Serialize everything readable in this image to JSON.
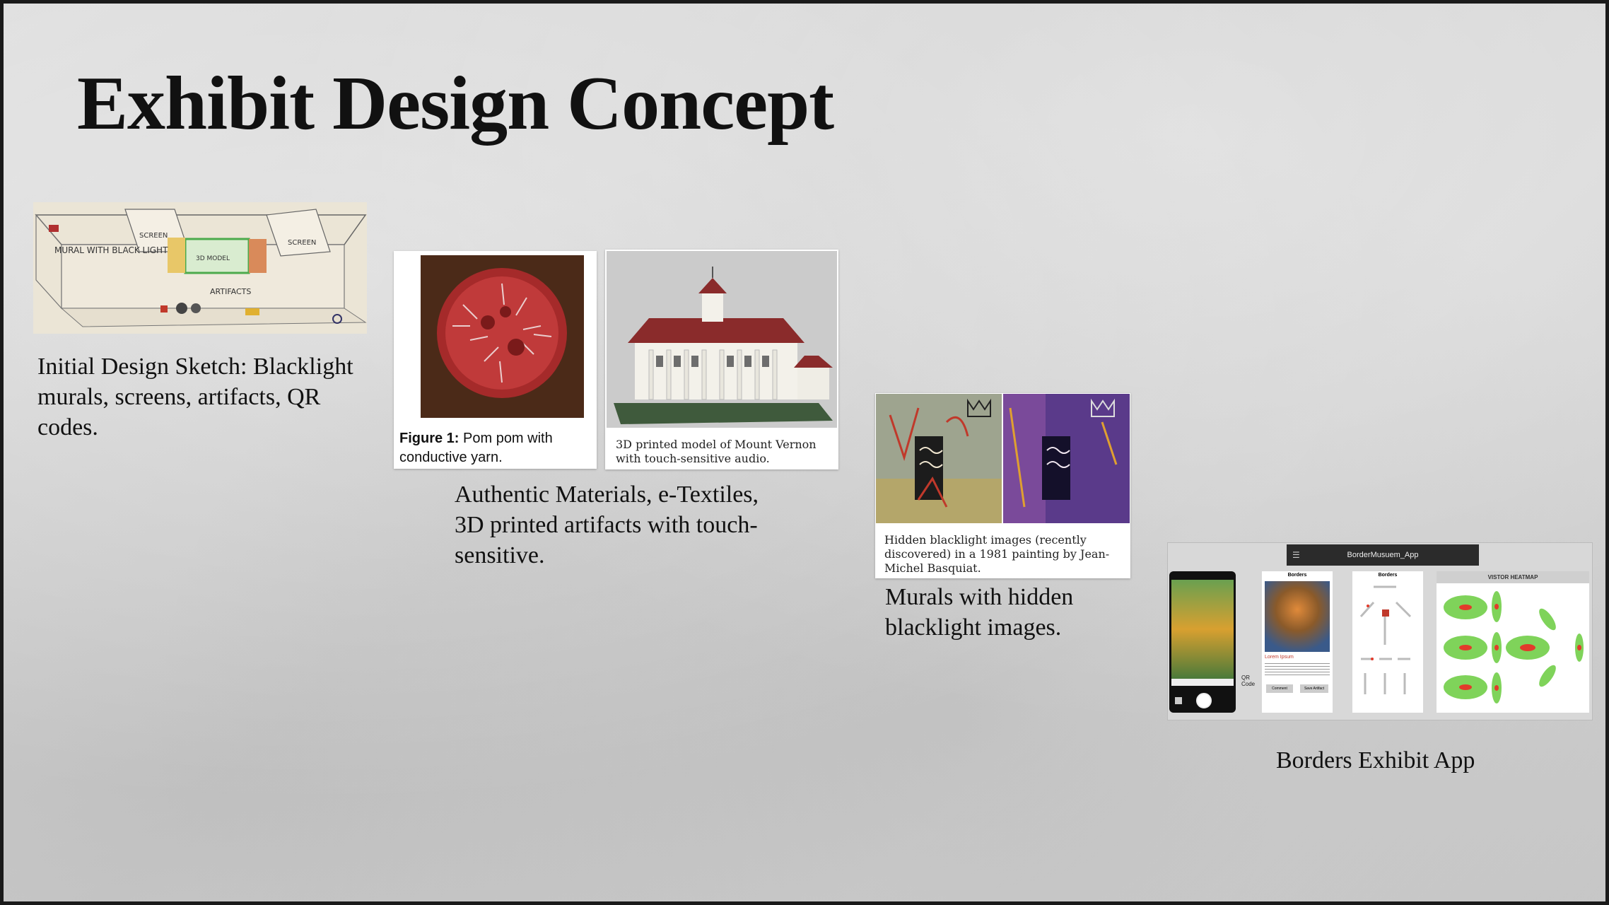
{
  "slide": {
    "title": "Exhibit Design Concept"
  },
  "sketch": {
    "caption": "Initial Design Sketch: Blacklight murals, screens, artifacts, QR codes.",
    "labels": [
      "MURAL WITH BLACK LIGHT",
      "SCREEN",
      "3D MODEL",
      "SCREEN",
      "ARTIFACTS"
    ]
  },
  "pompom": {
    "caption_bold": "Figure 1:",
    "caption_text": " Pom pom with conductive yarn."
  },
  "vernon": {
    "caption": "3D printed model of Mount Vernon with touch-sensitive audio."
  },
  "materials": {
    "caption": "Authentic Materials, e-Textiles, 3D printed artifacts with touch-sensitive."
  },
  "murals": {
    "photo_caption": "Hidden blacklight images (recently discovered) in a 1981 painting by Jean-Michel Basquiat.",
    "caption": "Murals with hidden blacklight images."
  },
  "app": {
    "bar_title": "BorderMusuem_App",
    "screen2_title": "Borders",
    "screen2_subtitle": "Lorem Ipsum",
    "screen2_btn1": "Comment",
    "screen2_btn2": "Save Artifact",
    "screen3_title": "Borders",
    "qr_label": "QR Code",
    "heatmap_label": "VISTOR HEATMAP",
    "caption": "Borders Exhibit App"
  }
}
